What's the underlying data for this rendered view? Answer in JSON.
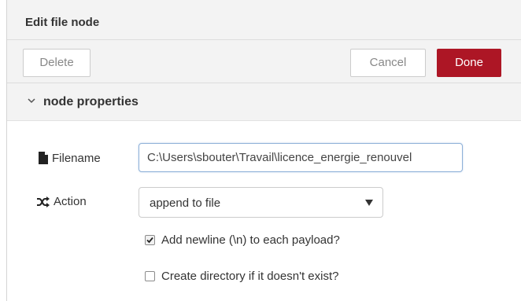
{
  "tray": {
    "title": "Edit file node",
    "delete_label": "Delete",
    "cancel_label": "Cancel",
    "done_label": "Done"
  },
  "section": {
    "title": "node properties"
  },
  "form": {
    "filename": {
      "label": "Filename",
      "value": "C:\\Users\\sbouter\\Travail\\licence_energie_renouvel",
      "icon": "file-icon"
    },
    "action": {
      "label": "Action",
      "selected": "append to file",
      "icon": "shuffle-icon"
    },
    "add_newline": {
      "label": "Add newline (\\n) to each payload?",
      "checked": true
    },
    "create_directory": {
      "label": "Create directory if it doesn't exist?",
      "checked": false
    }
  },
  "colors": {
    "done_button": "#ad1625",
    "header_background": "#f3f3f3"
  }
}
